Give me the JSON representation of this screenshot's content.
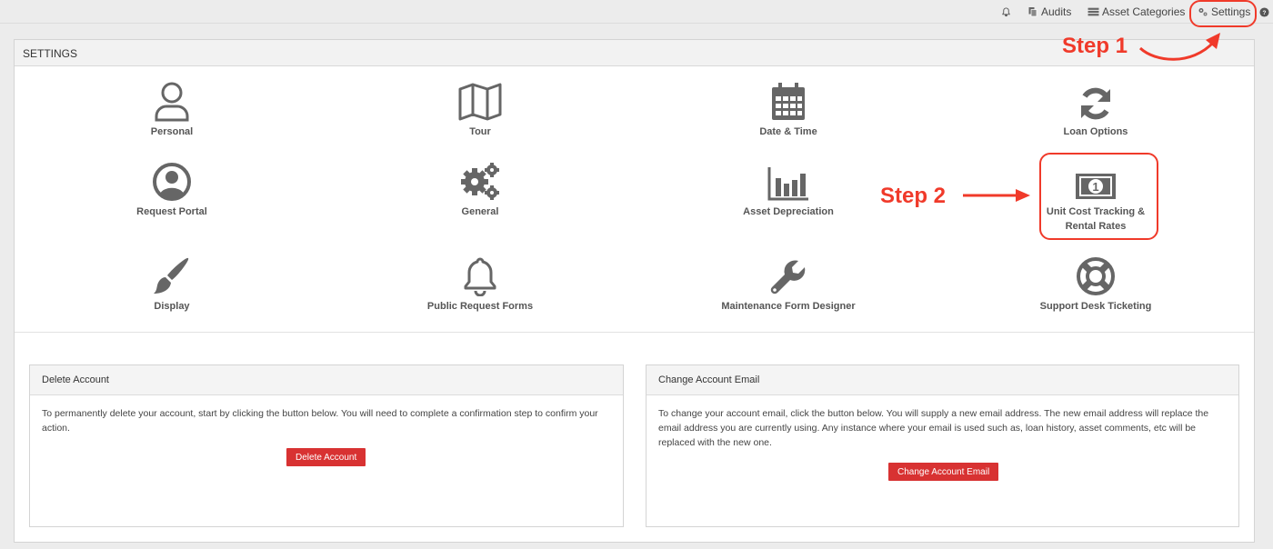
{
  "topnav": {
    "audits": "Audits",
    "asset_categories": "Asset Categories",
    "settings": "Settings"
  },
  "settings_panel": {
    "title": "SETTINGS",
    "tiles": [
      {
        "label": "Personal",
        "icon": "user-icon"
      },
      {
        "label": "Tour",
        "icon": "map-icon"
      },
      {
        "label": "Date & Time",
        "icon": "calendar-icon"
      },
      {
        "label": "Loan Options",
        "icon": "refresh-icon"
      },
      {
        "label": "Request Portal",
        "icon": "user-circle-icon"
      },
      {
        "label": "General",
        "icon": "cogs-icon"
      },
      {
        "label": "Asset Depreciation",
        "icon": "bar-chart-icon"
      },
      {
        "label": "Unit Cost Tracking &",
        "label2": "Rental Rates",
        "icon": "money-bill-icon"
      },
      {
        "label": "Display",
        "icon": "paint-brush-icon"
      },
      {
        "label": "Public Request Forms",
        "icon": "bell-icon"
      },
      {
        "label": "Maintenance Form Designer",
        "icon": "wrench-icon"
      },
      {
        "label": "Support Desk Ticketing",
        "icon": "life-ring-icon"
      }
    ]
  },
  "delete_account": {
    "title": "Delete Account",
    "text": "To permanently delete your account, start by clicking the button below. You will need to complete a confirmation step to confirm your action.",
    "button": "Delete Account"
  },
  "change_email": {
    "title": "Change Account Email",
    "text": "To change your account email, click the button below. You will supply a new email address. The new email address will replace the email address you are currently using. Any instance where your email is used such as, loan history, asset comments, etc will be replaced with the new one.",
    "button": "Change Account Email"
  },
  "annotations": {
    "step1": "Step 1",
    "step2": "Step 2",
    "color": "#f03a2a"
  },
  "colors": {
    "accent_red": "#d83232",
    "icon_gray": "#666666"
  }
}
